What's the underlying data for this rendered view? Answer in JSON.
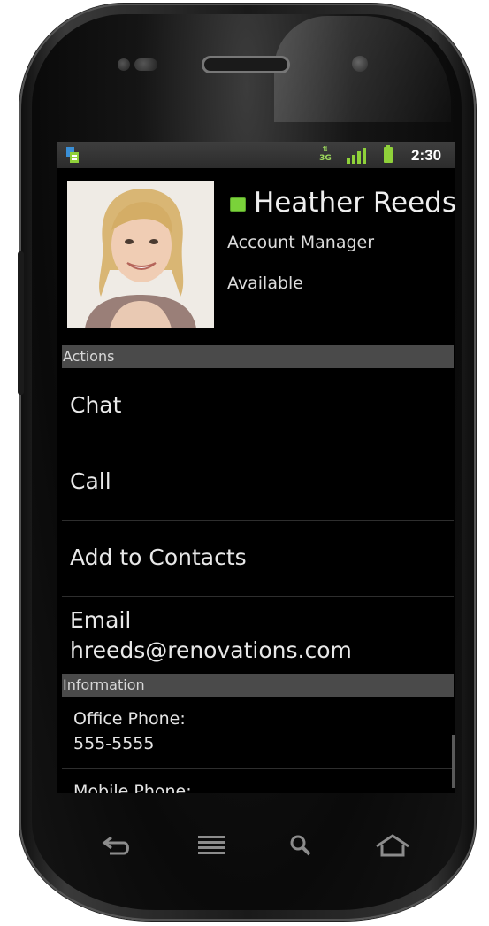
{
  "status_bar": {
    "network_type": "3G",
    "time": "2:30",
    "icons": [
      "notification-icon",
      "3g-data-icon",
      "signal-icon",
      "battery-icon"
    ]
  },
  "contact": {
    "name": "Heather Reeds",
    "title": "Account Manager",
    "status": "Available",
    "presence_color": "#7ad23a"
  },
  "actions": {
    "header": "Actions",
    "items": [
      {
        "label": "Chat"
      },
      {
        "label": "Call"
      },
      {
        "label": "Add to Contacts"
      }
    ],
    "email": {
      "label": "Email",
      "address": "hreeds@renovations.com"
    }
  },
  "information": {
    "header": "Information",
    "items": [
      {
        "label": "Office Phone:",
        "value": "555-5555"
      },
      {
        "label": "Mobile Phone:",
        "value": ""
      }
    ]
  },
  "nav_bar": {
    "buttons": [
      "back-icon",
      "menu-icon",
      "search-icon",
      "home-icon"
    ]
  }
}
